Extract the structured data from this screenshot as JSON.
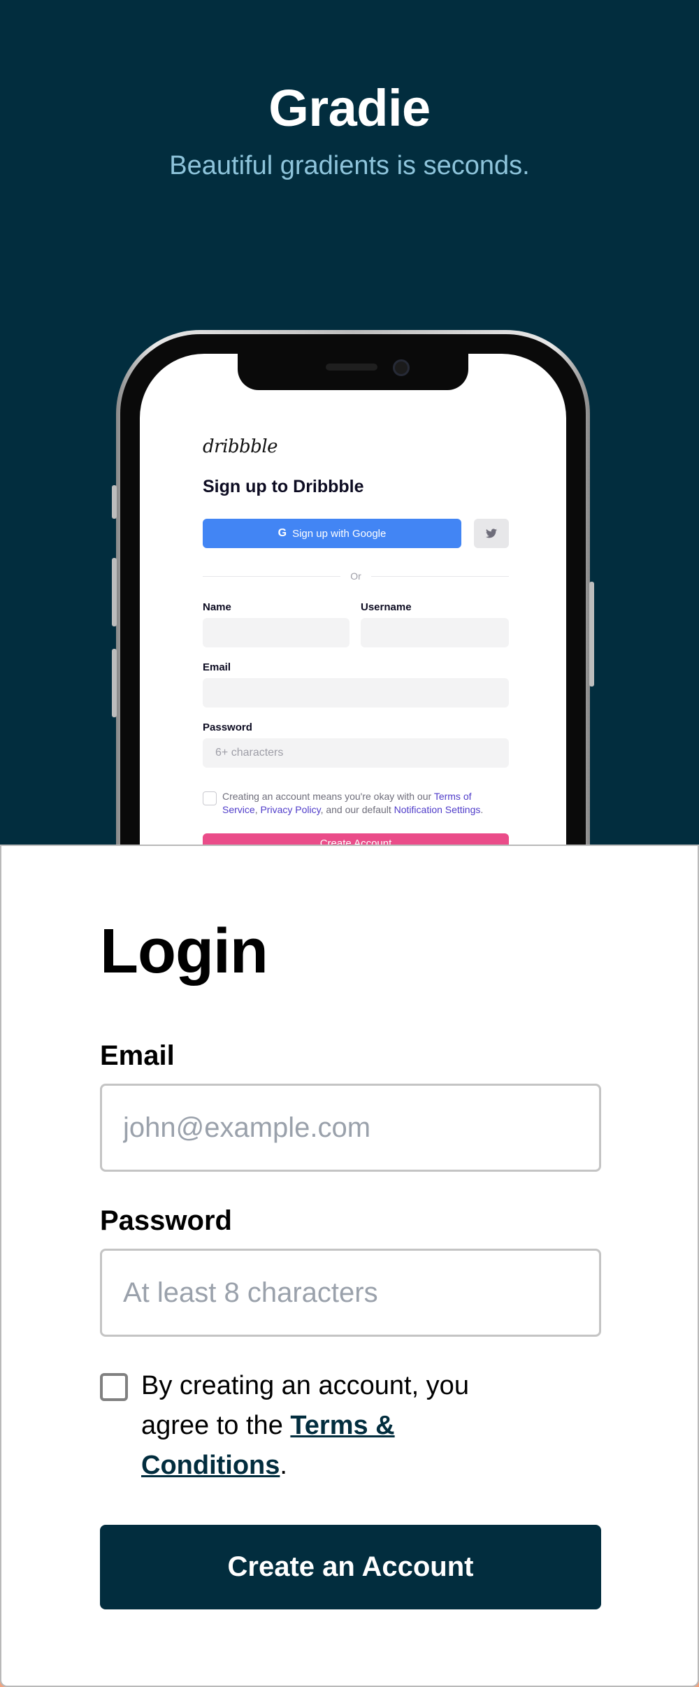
{
  "hero": {
    "title": "Gradie",
    "subtitle": "Beautiful gradients is seconds."
  },
  "phone": {
    "logo": "dribbble",
    "title": "Sign up to Dribbble",
    "google_button": "Sign up with Google",
    "google_icon": "G",
    "or_text": "Or",
    "name_label": "Name",
    "username_label": "Username",
    "email_label": "Email",
    "password_label": "Password",
    "password_placeholder": "6+ characters",
    "terms_prefix": "Creating an account means you're okay with our ",
    "terms_link1": "Terms of Service",
    "terms_sep1": ", ",
    "terms_link2": "Privacy Policy",
    "terms_mid": ", and our default ",
    "terms_link3": "Notification Settings",
    "terms_end": ".",
    "create_button": "Create Account"
  },
  "login": {
    "title": "Login",
    "email_label": "Email",
    "email_placeholder": "john@example.com",
    "password_label": "Password",
    "password_placeholder": "At least 8 characters",
    "terms_prefix": "By creating an account, you agree to the ",
    "terms_link": "Terms & Conditions",
    "terms_suffix": ".",
    "create_button": "Create an Account"
  },
  "colors": {
    "hero_bg": "#022d3e",
    "hero_subtitle": "#8ec4db",
    "primary": "#022d3e",
    "google_blue": "#4285f4",
    "dribbble_pink": "#ea4c89"
  }
}
